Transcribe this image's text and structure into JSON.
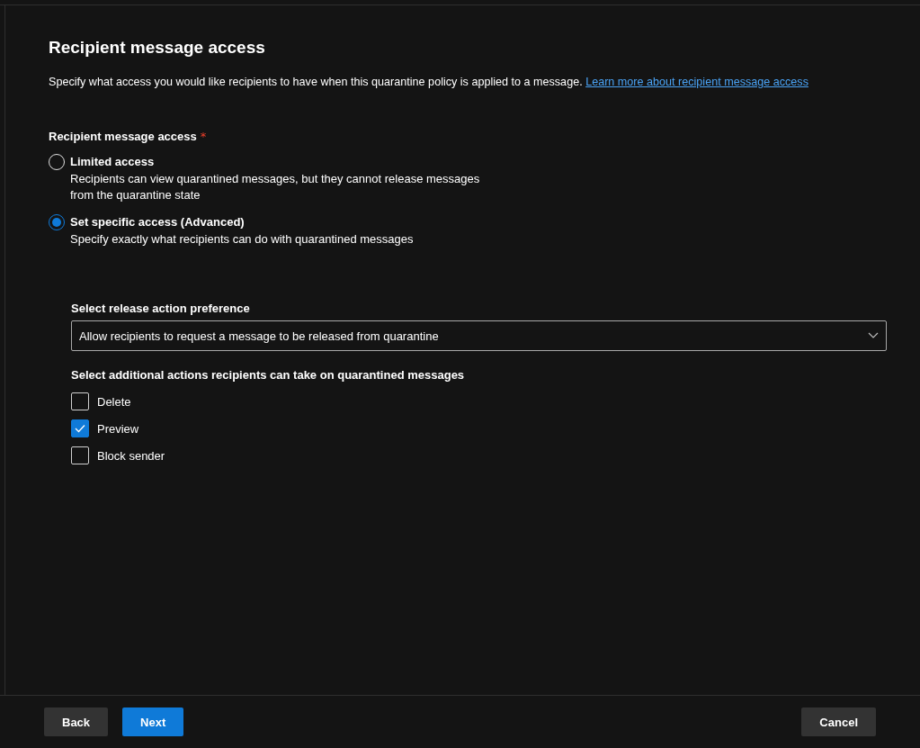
{
  "title": "Recipient message access",
  "description": {
    "text": "Specify what access you would like recipients to have when this quarantine policy is applied to a message.",
    "link": "Learn more about recipient message access"
  },
  "access": {
    "label": "Recipient message access",
    "required_mark": "*",
    "options": [
      {
        "label": "Limited access",
        "description": "Recipients can view quarantined messages, but they cannot release messages from the quarantine state",
        "selected": false
      },
      {
        "label": "Set specific access (Advanced)",
        "description": "Specify exactly what recipients can do with quarantined messages",
        "selected": true
      }
    ]
  },
  "release": {
    "label": "Select release action preference",
    "value": "Allow recipients to request a message to be released from quarantine"
  },
  "actions": {
    "label": "Select additional actions recipients can take on quarantined messages",
    "items": [
      {
        "label": "Delete",
        "checked": false
      },
      {
        "label": "Preview",
        "checked": true
      },
      {
        "label": "Block sender",
        "checked": false
      }
    ]
  },
  "footer": {
    "buttons": [
      {
        "label": "Back",
        "kind": "secondary"
      },
      {
        "label": "Next",
        "kind": "primary"
      },
      {
        "label": "Cancel",
        "kind": "secondary"
      }
    ]
  }
}
